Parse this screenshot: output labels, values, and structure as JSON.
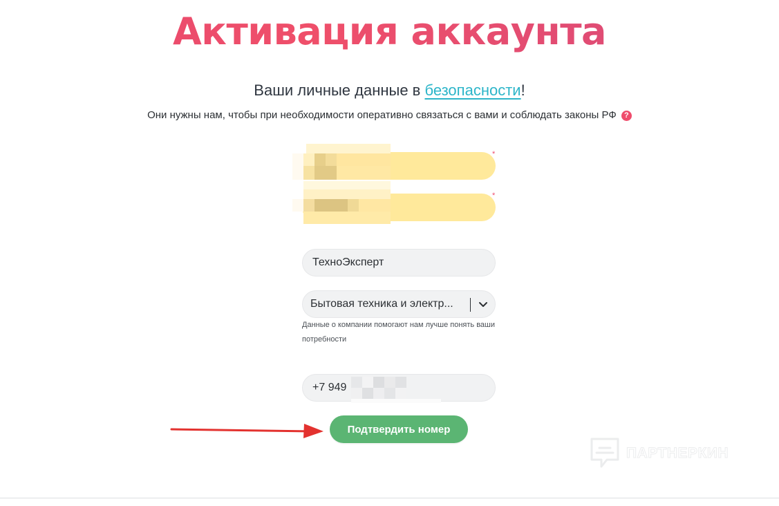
{
  "header": {
    "title": "Активация аккаунта"
  },
  "intro": {
    "subtitle_before": "Ваши личные данные в ",
    "subtitle_link": "безопасности",
    "subtitle_after": "!",
    "description": "Они нужны нам, чтобы при необходимости оперативно связаться с вами и соблюдать законы РФ",
    "help_symbol": "?"
  },
  "form": {
    "first_field": {
      "value": "",
      "required_mark": "*",
      "state": "redacted"
    },
    "second_field": {
      "value": "",
      "required_mark": "*",
      "state": "redacted"
    },
    "company_field": {
      "value": "ТехноЭксперт"
    },
    "industry_select": {
      "selected": "Бытовая техника и электр..."
    },
    "company_hint": "Данные о компании помогают нам лучше понять ваши потребности",
    "phone_field": {
      "value": "+7 949",
      "state": "partially-redacted"
    },
    "confirm_button_label": "Подтвердить номер"
  },
  "watermark": {
    "text": "ПАРТНЕРКИН"
  },
  "colors": {
    "title": "#e8496f",
    "link": "#2cb5c9",
    "help_icon": "#ef4c6c",
    "required_field_bg": "#ffe99b",
    "input_bg": "#f1f2f3",
    "button_bg": "#5bb573",
    "arrow": "#e3322f"
  },
  "icons": {
    "help": "question-circle-icon",
    "select": "chevron-down-icon",
    "annotation": "arrow-right-icon",
    "watermark": "partnerkin-logo-icon"
  }
}
